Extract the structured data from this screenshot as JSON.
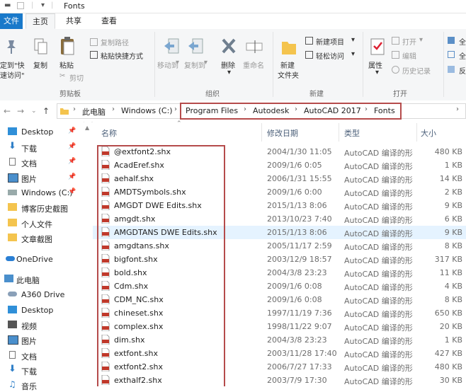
{
  "window": {
    "title": "Fonts"
  },
  "tabs": {
    "file": "文件",
    "home": "主页",
    "share": "共享",
    "view": "查看"
  },
  "ribbon": {
    "pin_quick": "定到\"快",
    "pin_quick2": "速访问\"",
    "copy": "复制",
    "paste": "粘贴",
    "copy_path": "复制路径",
    "paste_shortcut": "粘贴快捷方式",
    "cut": "剪切",
    "clipboard_group": "剪贴板",
    "move_to": "移动到",
    "copy_to": "复制到",
    "delete": "删除",
    "rename": "重命名",
    "organize_group": "组织",
    "new_item": "新建项目",
    "easy_access": "轻松访问",
    "new_folder": "新建",
    "new_folder2": "文件夹",
    "new_group": "新建",
    "properties": "属性",
    "open": "打开",
    "edit": "编辑",
    "history": "历史记录",
    "open_group": "打开",
    "select_all_partial": "全",
    "select_none_partial": "全",
    "invert_partial": "反"
  },
  "address": {
    "crumbs": [
      "此电脑",
      "Windows (C:)",
      "Program Files",
      "Autodesk",
      "AutoCAD 2017",
      "Fonts"
    ]
  },
  "nav": {
    "items": [
      {
        "label": "Desktop",
        "pinned": true
      },
      {
        "label": "下载",
        "pinned": true
      },
      {
        "label": "文档",
        "pinned": true
      },
      {
        "label": "图片",
        "pinned": true
      },
      {
        "label": "Windows (C:)",
        "pinned": true
      },
      {
        "label": "博客历史截图",
        "pinned": false
      },
      {
        "label": "个人文件",
        "pinned": false
      },
      {
        "label": "文章截图",
        "pinned": false
      },
      {
        "label": "OneDrive",
        "pinned": false
      },
      {
        "label": "此电脑",
        "pinned": false
      },
      {
        "label": "A360 Drive",
        "pinned": false
      },
      {
        "label": "Desktop",
        "pinned": false
      },
      {
        "label": "视频",
        "pinned": false
      },
      {
        "label": "图片",
        "pinned": false
      },
      {
        "label": "文档",
        "pinned": false
      },
      {
        "label": "下载",
        "pinned": false
      },
      {
        "label": "音乐",
        "pinned": false
      }
    ],
    "pin_glyph": "📌"
  },
  "list": {
    "headers": {
      "name": "名称",
      "date": "修改日期",
      "type": "类型",
      "size": "大小"
    },
    "rows": [
      {
        "name": "@extfont2.shx",
        "date": "2004/1/30 11:05",
        "type": "AutoCAD 编译的形",
        "size": "480 KB"
      },
      {
        "name": "AcadEref.shx",
        "date": "2009/1/6 0:05",
        "type": "AutoCAD 编译的形",
        "size": "1 KB"
      },
      {
        "name": "aehalf.shx",
        "date": "2006/1/31 15:55",
        "type": "AutoCAD 编译的形",
        "size": "14 KB"
      },
      {
        "name": "AMDTSymbols.shx",
        "date": "2009/1/6 0:00",
        "type": "AutoCAD 编译的形",
        "size": "2 KB"
      },
      {
        "name": "AMGDT DWE Edits.shx",
        "date": "2015/1/13 8:06",
        "type": "AutoCAD 编译的形",
        "size": "9 KB"
      },
      {
        "name": "amgdt.shx",
        "date": "2013/10/23 7:40",
        "type": "AutoCAD 编译的形",
        "size": "6 KB"
      },
      {
        "name": "AMGDTANS DWE Edits.shx",
        "date": "2015/1/13 8:06",
        "type": "AutoCAD 编译的形",
        "size": "9 KB"
      },
      {
        "name": "amgdtans.shx",
        "date": "2005/11/17 2:59",
        "type": "AutoCAD 编译的形",
        "size": "8 KB"
      },
      {
        "name": "bigfont.shx",
        "date": "2003/12/9 18:57",
        "type": "AutoCAD 编译的形",
        "size": "317 KB"
      },
      {
        "name": "bold.shx",
        "date": "2004/3/8 23:23",
        "type": "AutoCAD 编译的形",
        "size": "11 KB"
      },
      {
        "name": "Cdm.shx",
        "date": "2009/1/6 0:08",
        "type": "AutoCAD 编译的形",
        "size": "4 KB"
      },
      {
        "name": "CDM_NC.shx",
        "date": "2009/1/6 0:08",
        "type": "AutoCAD 编译的形",
        "size": "8 KB"
      },
      {
        "name": "chineset.shx",
        "date": "1997/11/19 7:36",
        "type": "AutoCAD 编译的形",
        "size": "650 KB"
      },
      {
        "name": "complex.shx",
        "date": "1998/11/22 9:07",
        "type": "AutoCAD 编译的形",
        "size": "20 KB"
      },
      {
        "name": "dim.shx",
        "date": "2004/3/8 23:23",
        "type": "AutoCAD 编译的形",
        "size": "1 KB"
      },
      {
        "name": "extfont.shx",
        "date": "2003/11/28 17:40",
        "type": "AutoCAD 编译的形",
        "size": "427 KB"
      },
      {
        "name": "extfont2.shx",
        "date": "2006/7/27 17:33",
        "type": "AutoCAD 编译的形",
        "size": "480 KB"
      },
      {
        "name": "exthalf2.shx",
        "date": "2003/7/9 17:30",
        "type": "AutoCAD 编译的形",
        "size": "30 KB"
      }
    ],
    "selected_index": 6
  },
  "colors": {
    "accent": "#1979ca",
    "highlight_box": "#b54b4b",
    "selection": "#e5f3ff"
  }
}
